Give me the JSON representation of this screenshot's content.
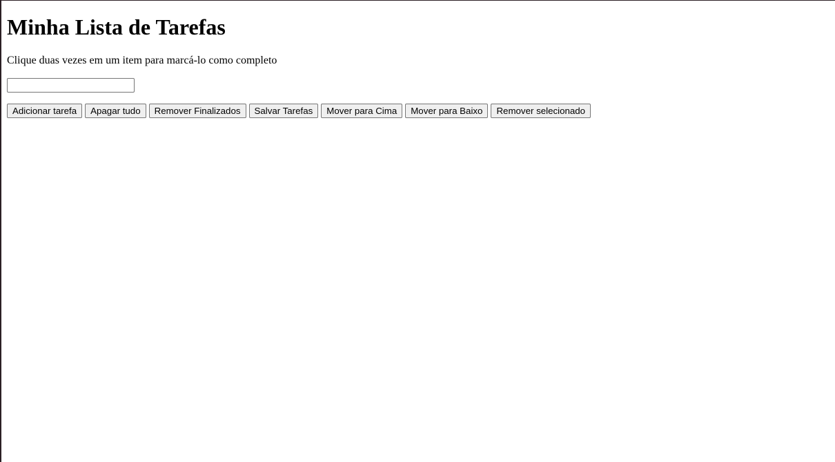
{
  "page": {
    "title": "Minha Lista de Tarefas",
    "instructions": "Clique duas vezes em um item para marcá-lo como completo"
  },
  "task_input": {
    "value": "",
    "placeholder": ""
  },
  "buttons": {
    "add": "Adicionar tarefa",
    "clear_all": "Apagar tudo",
    "remove_finished": "Remover Finalizados",
    "save": "Salvar Tarefas",
    "move_up": "Mover para Cima",
    "move_down": "Mover para Baixo",
    "remove_selected": "Remover selecionado"
  },
  "tasks": []
}
